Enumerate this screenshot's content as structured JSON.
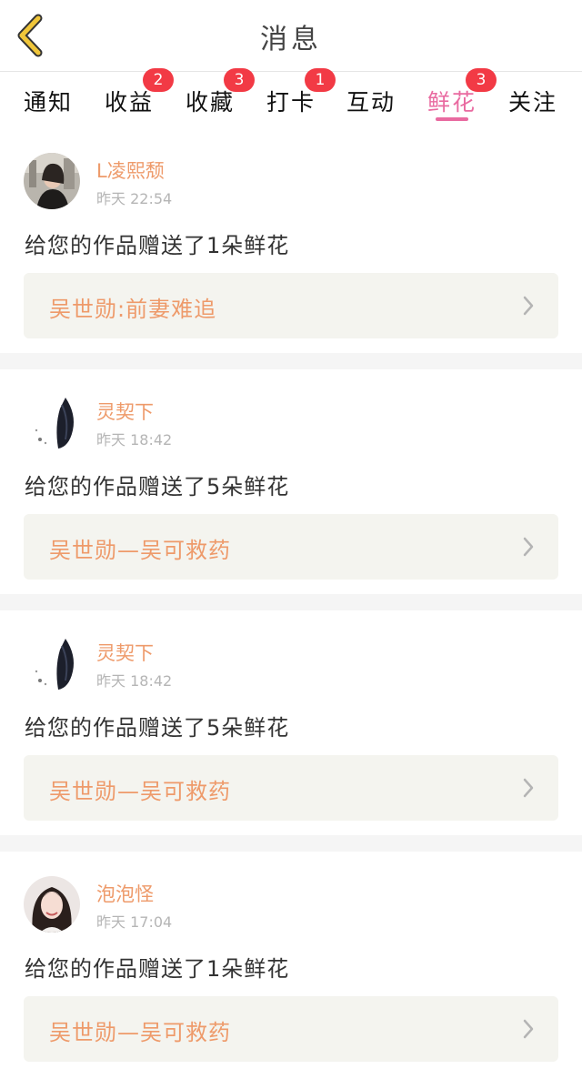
{
  "header": {
    "title": "消息"
  },
  "tabs": [
    {
      "label": "通知"
    },
    {
      "label": "收益",
      "badge": "2"
    },
    {
      "label": "收藏",
      "badge": "3"
    },
    {
      "label": "打卡",
      "badge": "1"
    },
    {
      "label": "互动"
    },
    {
      "label": "鲜花",
      "badge": "3",
      "active": true
    },
    {
      "label": "关注"
    }
  ],
  "messages": [
    {
      "user": "L凌熙颓",
      "time": "昨天  22:54",
      "text": "给您的作品赠送了1朵鲜花",
      "work": "吴世勋:前妻难追"
    },
    {
      "user": "灵契下",
      "time": "昨天  18:42",
      "text": "给您的作品赠送了5朵鲜花",
      "work": "吴世勋—吴可救药"
    },
    {
      "user": "灵契下",
      "time": "昨天  18:42",
      "text": "给您的作品赠送了5朵鲜花",
      "work": "吴世勋—吴可救药"
    },
    {
      "user": "泡泡怪",
      "time": "昨天  17:04",
      "text": "给您的作品赠送了1朵鲜花",
      "work": "吴世勋—吴可救药"
    }
  ],
  "colors": {
    "accent": "#e96aa0",
    "name": "#ee9a6a",
    "badge": "#f23a45",
    "back_icon": "#f0c63a"
  },
  "icons": {
    "back": "chevron-left-icon",
    "row": "chevron-right-icon"
  }
}
